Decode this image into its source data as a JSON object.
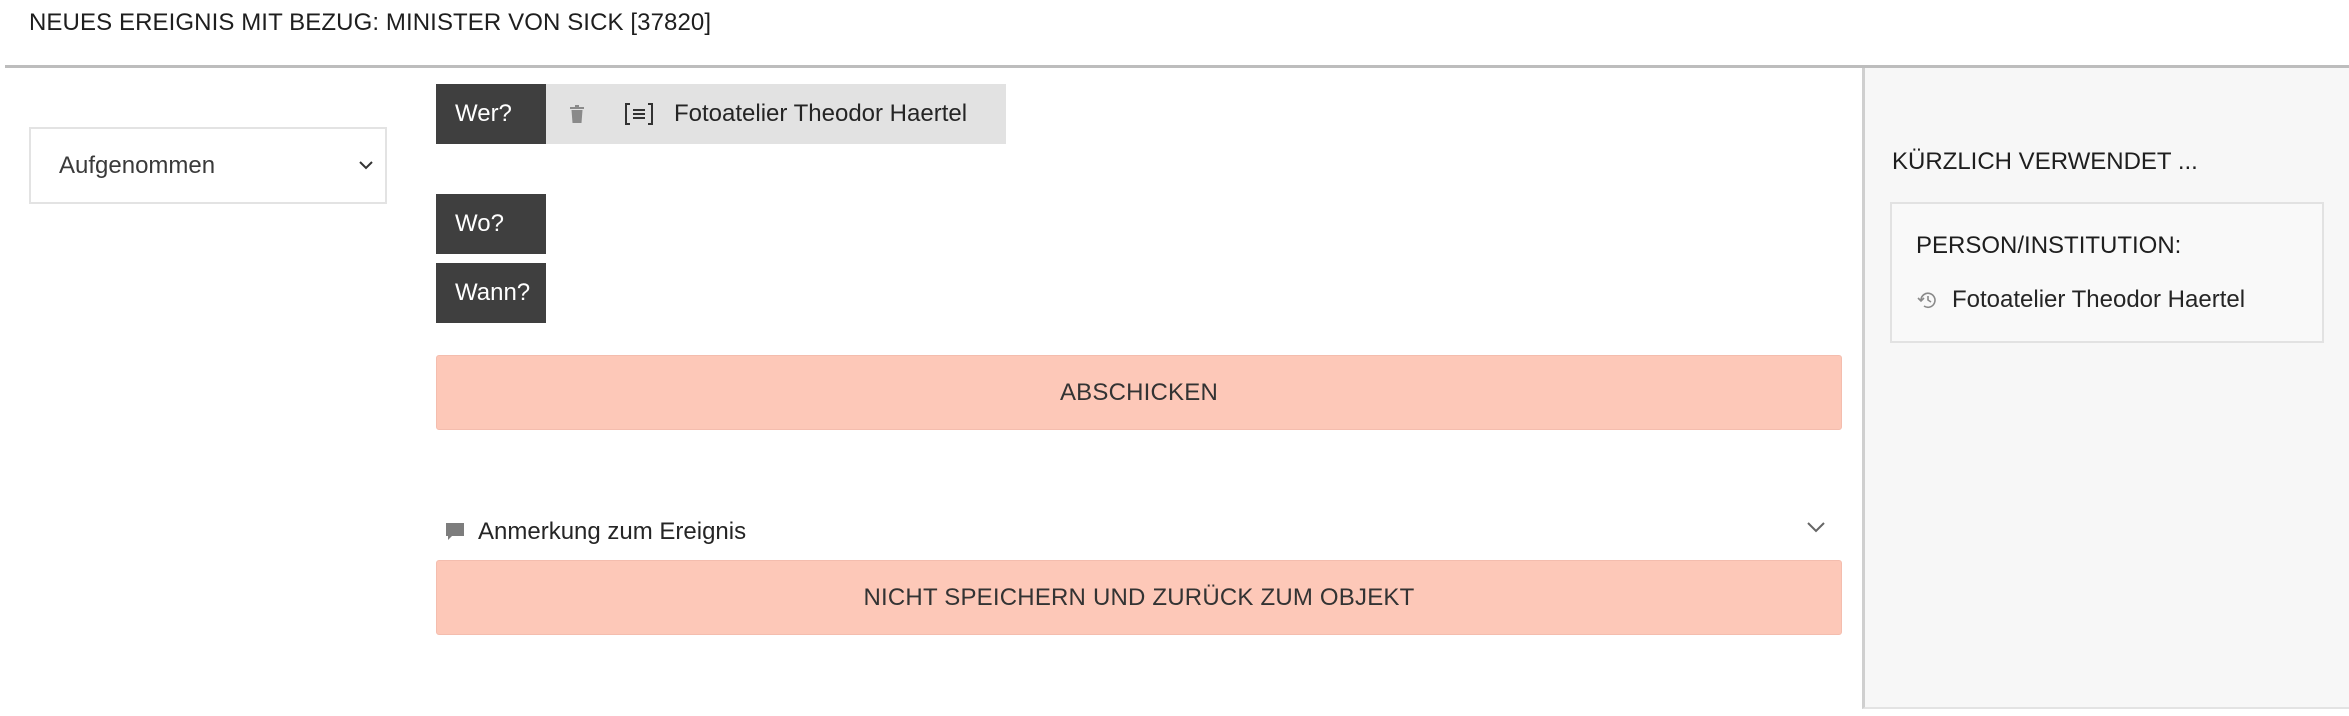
{
  "page": {
    "title": "NEUES EREIGNIS MIT BEZUG: MINISTER VON SICK [37820]"
  },
  "event_type": {
    "selected": "Aufgenommen"
  },
  "questions": {
    "who_label": "Wer?",
    "where_label": "Wo?",
    "when_label": "Wann?",
    "who_value": "Fotoatelier Theodor Haertel"
  },
  "actions": {
    "submit_label": "ABSCHICKEN",
    "note_label": "Anmerkung zum Ereignis",
    "cancel_label": "NICHT SPEICHERN UND ZURÜCK ZUM OBJEKT"
  },
  "recent": {
    "title": "KÜRZLICH VERWENDET ...",
    "category": "PERSON/INSTITUTION:",
    "items": [
      {
        "label": "Fotoatelier Theodor Haertel"
      }
    ]
  },
  "icons": {
    "select_chevron": "chevron-down-icon",
    "delete": "trash-icon",
    "details": "list-detail-icon",
    "note": "comment-icon",
    "note_chevron": "chevron-down-icon",
    "history": "history-icon"
  },
  "colors": {
    "question_button": "#3f3f3f",
    "chip_background": "#e2e2e2",
    "action_button": "#fdc8b8",
    "side_panel": "#f7f7f7"
  }
}
